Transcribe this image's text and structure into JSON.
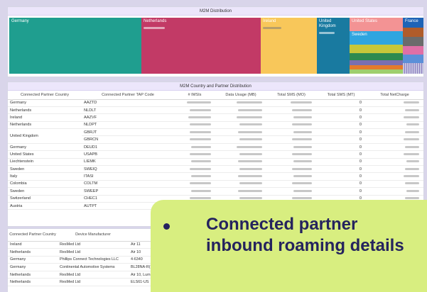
{
  "treemap": {
    "title": "M2M Distribution",
    "cells": [
      {
        "label": "Germany",
        "color": "#1f9e8f"
      },
      {
        "label": "Netherlands",
        "color": "#c23a66"
      },
      {
        "label": "Ireland",
        "color": "#f8c75a"
      },
      {
        "label": "United Kingdom",
        "color": "#197aa0"
      },
      {
        "label": "United States",
        "color": "#f39394"
      },
      {
        "label": "Sweden",
        "color": "#2fa5e0"
      },
      {
        "label": "France",
        "color": "#1e63b6"
      }
    ],
    "small_colors": [
      "#c7c73a",
      "#2d8a50",
      "#7a6fb0",
      "#e47b2b",
      "#9fcf6d",
      "#b05c2a",
      "#6b6b6b",
      "#e06fa6",
      "#5b8fd8",
      "#c3c3e0"
    ]
  },
  "country_table": {
    "title": "M2M Country and Partner Distribution",
    "columns": [
      "Connected Partner Country",
      "Connected Partner TAP Code",
      "# IMSIs",
      "Data Usage (MB)",
      "Total SMS (MO)",
      "Total SMS (MT)",
      "Total NetCharge"
    ],
    "rows": [
      {
        "country": "Germany",
        "tap": "AAZTD",
        "mt": "0"
      },
      {
        "country": "Netherlands",
        "tap": "NLDLT",
        "mt": "0"
      },
      {
        "country": "Ireland",
        "tap": "AAZVF",
        "mt": "0"
      },
      {
        "country": "Netherlands",
        "tap": "NLDPT",
        "mt": "0"
      },
      {
        "country": "United Kingdom",
        "tap": "GBRJT",
        "mt": "0"
      },
      {
        "country": "",
        "tap": "GBRCN",
        "mt": "0"
      },
      {
        "country": "Germany",
        "tap": "DEUD1",
        "mt": "0"
      },
      {
        "country": "United States",
        "tap": "USAPB",
        "mt": "0"
      },
      {
        "country": "Liechtenstein",
        "tap": "LIEMK",
        "mt": "0"
      },
      {
        "country": "Sweden",
        "tap": "SWEIQ",
        "mt": "0"
      },
      {
        "country": "Italy",
        "tap": "ITASI",
        "mt": "0"
      },
      {
        "country": "Colombia",
        "tap": "COLTM",
        "mt": "0"
      },
      {
        "country": "Sweden",
        "tap": "SWEEP",
        "mt": "0"
      },
      {
        "country": "Switzerland",
        "tap": "CHEC1",
        "mt": "0"
      },
      {
        "country": "Austria",
        "tap": "AUTPT",
        "mt": "0"
      }
    ]
  },
  "device_table": {
    "columns": [
      "Connected Partner Country",
      "Device Manufacturer",
      ""
    ],
    "rows": [
      {
        "country": "Ireland",
        "manufacturer": "ResMed Ltd",
        "model": "Air 11"
      },
      {
        "country": "Netherlands",
        "manufacturer": "ResMed Ltd",
        "model": "Air 10"
      },
      {
        "country": "Germany",
        "manufacturer": "Phillips Connect Technologies LLC",
        "model": "4-6340"
      },
      {
        "country": "Germany",
        "manufacturer": "Continental Automotive Systems",
        "model": "BL28NA-R("
      },
      {
        "country": "Netherlands",
        "manufacturer": "ResMed Ltd",
        "model": "Air 10, Lum"
      },
      {
        "country": "Netherlands",
        "manufacturer": "ResMed Ltd",
        "model": "ELS61-US"
      }
    ]
  },
  "callout": {
    "text": "Connected partner inbound roaming details"
  }
}
